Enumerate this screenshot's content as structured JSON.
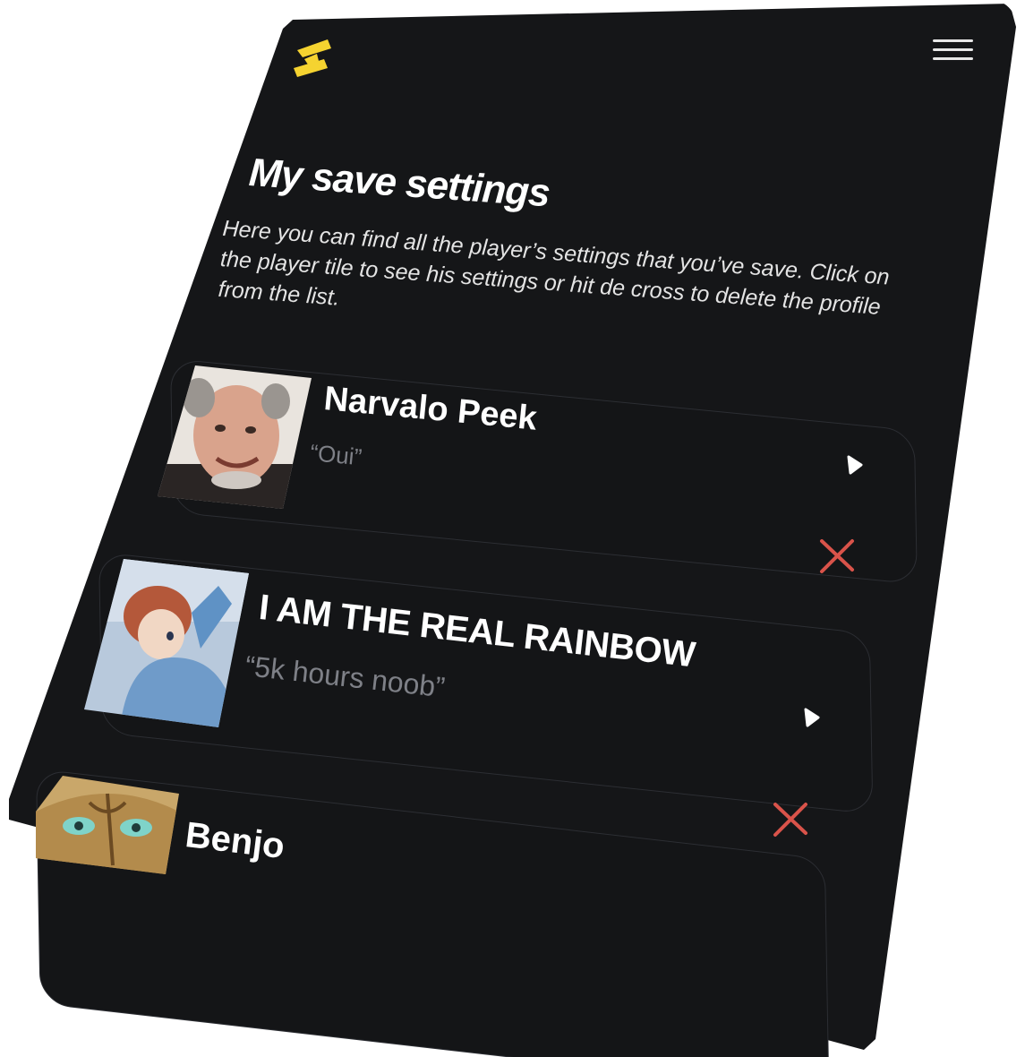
{
  "header": {
    "logo_icon": "brand-logo-icon",
    "menu_icon": "hamburger-menu-icon",
    "brand_color": "#f5d330"
  },
  "page": {
    "title": "My save settings",
    "description": "Here you can find all the player’s settings that you’ve save. Click on the player tile to see his settings or hit de cross to delete the profile from the list."
  },
  "players": [
    {
      "name": "Narvalo Peek",
      "quote": "“Oui”",
      "avatar": "player-photo",
      "delete_color": "#d9534a"
    },
    {
      "name": "I AM THE REAL RAINBOW",
      "quote": "“5k hours noob”",
      "avatar": "anime-character-illustration",
      "delete_color": "#d9534a"
    },
    {
      "name": "Benjo",
      "quote": "",
      "avatar": "ornate-mask-illustration"
    }
  ]
}
